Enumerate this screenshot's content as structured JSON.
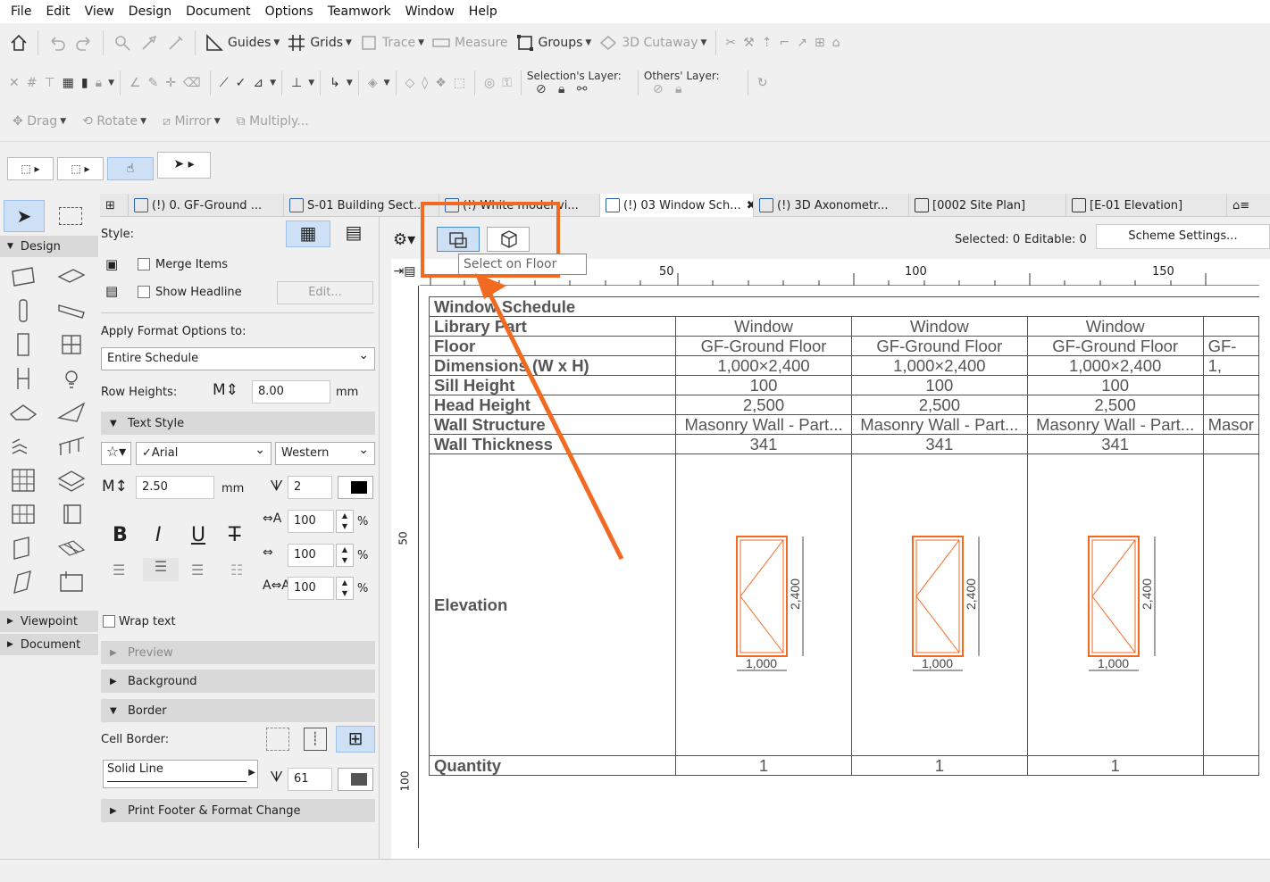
{
  "menu": [
    "File",
    "Edit",
    "View",
    "Design",
    "Document",
    "Options",
    "Teamwork",
    "Window",
    "Help"
  ],
  "toolbar1": {
    "guides": "Guides",
    "grids": "Grids",
    "trace": "Trace",
    "measure": "Measure",
    "groups": "Groups",
    "cutaway": "3D Cutaway"
  },
  "toolbar2": {
    "selection_layer": "Selection's Layer:",
    "others_layer": "Others' Layer:"
  },
  "toolbar3": {
    "drag": "Drag",
    "rotate": "Rotate",
    "mirror": "Mirror",
    "multiply": "Multiply..."
  },
  "tabs": [
    "(!) 0. GF-Ground ...",
    "S-01 Building Sect...",
    "(!) White model vi...",
    "(!) 03 Window Sch...",
    "(!) 3D Axonometr...",
    "[0002 Site Plan]",
    "[E-01 Elevation]"
  ],
  "toolbox": {
    "design": "Design",
    "viewpoint": "Viewpoint",
    "document": "Document"
  },
  "settings": {
    "style": "Style:",
    "merge_items": "Merge Items",
    "show_headline": "Show Headline",
    "edit": "Edit...",
    "apply_format": "Apply Format Options to:",
    "apply_value": "Entire Schedule",
    "row_heights": "Row Heights:",
    "row_height_value": "8.00",
    "mm": "mm",
    "text_style": "Text Style",
    "font": "✓Arial",
    "script": "Western",
    "font_size": "2.50",
    "pen": "2",
    "pct1": "100",
    "pct2": "100",
    "pct3": "100",
    "pct": "%",
    "bold": "B",
    "italic": "I",
    "underline": "U",
    "strike": "T",
    "wrap_text": "Wrap text",
    "preview": "Preview",
    "background": "Background",
    "border": "Border",
    "cell_border": "Cell Border:",
    "line_type": "Solid Line",
    "border_pen": "61",
    "print_footer": "Print Footer & Format Change"
  },
  "content": {
    "selected": "Selected: 0",
    "editable": "Editable: 0",
    "scheme_settings": "Scheme Settings...",
    "tooltip": "Select on Floor",
    "ruler_top": [
      "50",
      "100",
      "150"
    ],
    "ruler_left": [
      "50",
      "100"
    ]
  },
  "schedule": {
    "title": "Window Schedule",
    "rows": [
      {
        "label": "Library Part",
        "values": [
          "Window",
          "Window",
          "Window",
          ""
        ]
      },
      {
        "label": "Floor",
        "values": [
          "GF-Ground Floor",
          "GF-Ground Floor",
          "GF-Ground Floor",
          "GF-"
        ]
      },
      {
        "label": "Dimensions (W x H)",
        "values": [
          "1,000×2,400",
          "1,000×2,400",
          "1,000×2,400",
          "1,"
        ]
      },
      {
        "label": "Sill Height",
        "values": [
          "100",
          "100",
          "100",
          ""
        ]
      },
      {
        "label": "Head Height",
        "values": [
          "2,500",
          "2,500",
          "2,500",
          ""
        ]
      },
      {
        "label": "Wall Structure",
        "values": [
          "Masonry Wall - Part...",
          "Masonry Wall - Part...",
          "Masonry Wall - Part...",
          "Masor"
        ]
      },
      {
        "label": "Wall Thickness",
        "values": [
          "341",
          "341",
          "341",
          ""
        ]
      }
    ],
    "elevation_label": "Elevation",
    "dim_height": "2,400",
    "dim_width": "1,000",
    "quantity_label": "Quantity",
    "quantity_values": [
      "1",
      "1",
      "1",
      ""
    ]
  },
  "colors": {
    "accent": "#f26a21",
    "active_blue": "#2a5ea8"
  }
}
